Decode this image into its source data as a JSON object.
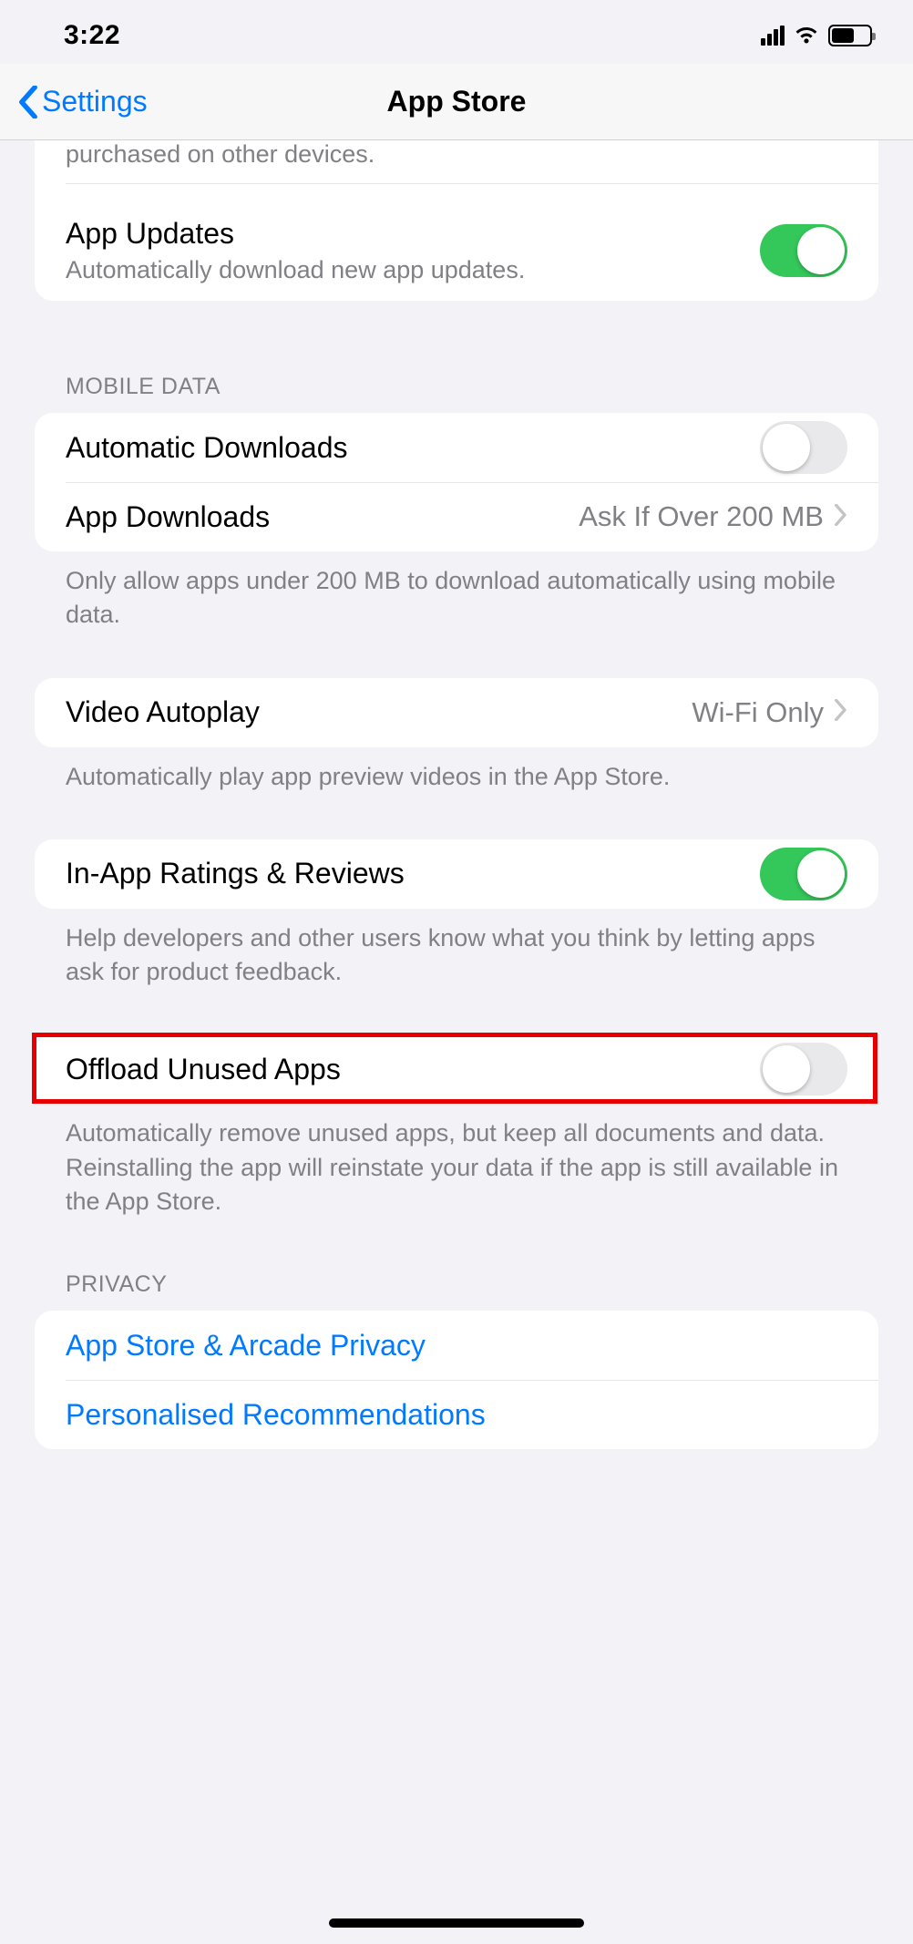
{
  "status": {
    "time": "3:22"
  },
  "nav": {
    "back": "Settings",
    "title": "App Store"
  },
  "partial_prev_footer": "purchased on other devices.",
  "app_updates": {
    "title": "App Updates",
    "subtitle": "Automatically download new app updates."
  },
  "mobile_data": {
    "header": "MOBILE DATA",
    "auto_downloads": "Automatic Downloads",
    "app_downloads": {
      "title": "App Downloads",
      "value": "Ask If Over 200 MB"
    },
    "footer": "Only allow apps under 200 MB to download automatically using mobile data."
  },
  "video_autoplay": {
    "title": "Video Autoplay",
    "value": "Wi-Fi Only",
    "footer": "Automatically play app preview videos in the App Store."
  },
  "ratings": {
    "title": "In-App Ratings & Reviews",
    "footer": "Help developers and other users know what you think by letting apps ask for product feedback."
  },
  "offload": {
    "title": "Offload Unused Apps",
    "footer": "Automatically remove unused apps, but keep all documents and data. Reinstalling the app will reinstate your data if the app is still available in the App Store."
  },
  "privacy": {
    "header": "PRIVACY",
    "appstore": "App Store & Arcade Privacy",
    "recommendations": "Personalised Recommendations"
  }
}
